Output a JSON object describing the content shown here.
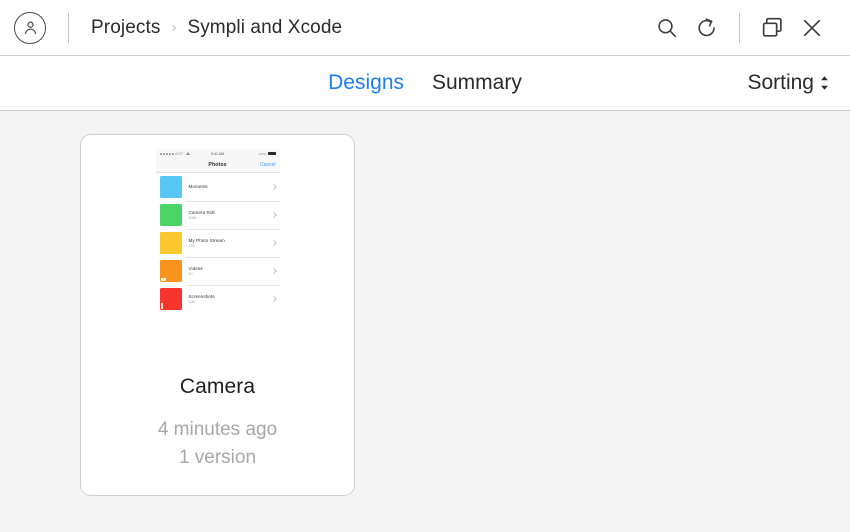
{
  "topbar": {
    "avatar_icon": "user-circle-icon",
    "breadcrumb": {
      "root": "Projects",
      "separator": "›",
      "current": "Sympli and Xcode"
    },
    "actions": {
      "search_icon": "search-icon",
      "refresh_icon": "refresh-icon",
      "windows_icon": "windows-stack-icon",
      "close_icon": "close-icon"
    }
  },
  "tabbar": {
    "tabs": [
      {
        "label": "Designs",
        "active": true
      },
      {
        "label": "Summary",
        "active": false
      }
    ],
    "sorting": {
      "label": "Sorting",
      "icon": "sort-updown-icon"
    }
  },
  "content": {
    "cards": [
      {
        "title": "Camera",
        "modified": "4 minutes ago",
        "versions": "1 version",
        "thumbnail": {
          "type": "ios-photos-screen",
          "statusbar": {
            "carrier": "AT&T",
            "time": "9:41 AM",
            "battery": "100%"
          },
          "navbar": {
            "title": "Photos",
            "action": "Cancel"
          },
          "rows": [
            {
              "label": "Moments",
              "count": "",
              "color": "#57c7f5",
              "badge": "none"
            },
            {
              "label": "Camera Roll",
              "count": "1081",
              "color": "#4cd468",
              "badge": "none"
            },
            {
              "label": "My Photo Stream",
              "count": "176",
              "color": "#fcc72e",
              "badge": "none"
            },
            {
              "label": "Videos",
              "count": "10",
              "color": "#f7941e",
              "badge": "video"
            },
            {
              "label": "Screenshots",
              "count": "108",
              "color": "#f7352c",
              "badge": "bar"
            }
          ]
        }
      }
    ]
  },
  "colors": {
    "accent": "#1b7ff6",
    "page_bg": "#f4f4f4",
    "panel_bg": "#ffffff",
    "text": "#2b2b2b",
    "muted": "#a8a8a8",
    "border": "#cfcfcf"
  }
}
